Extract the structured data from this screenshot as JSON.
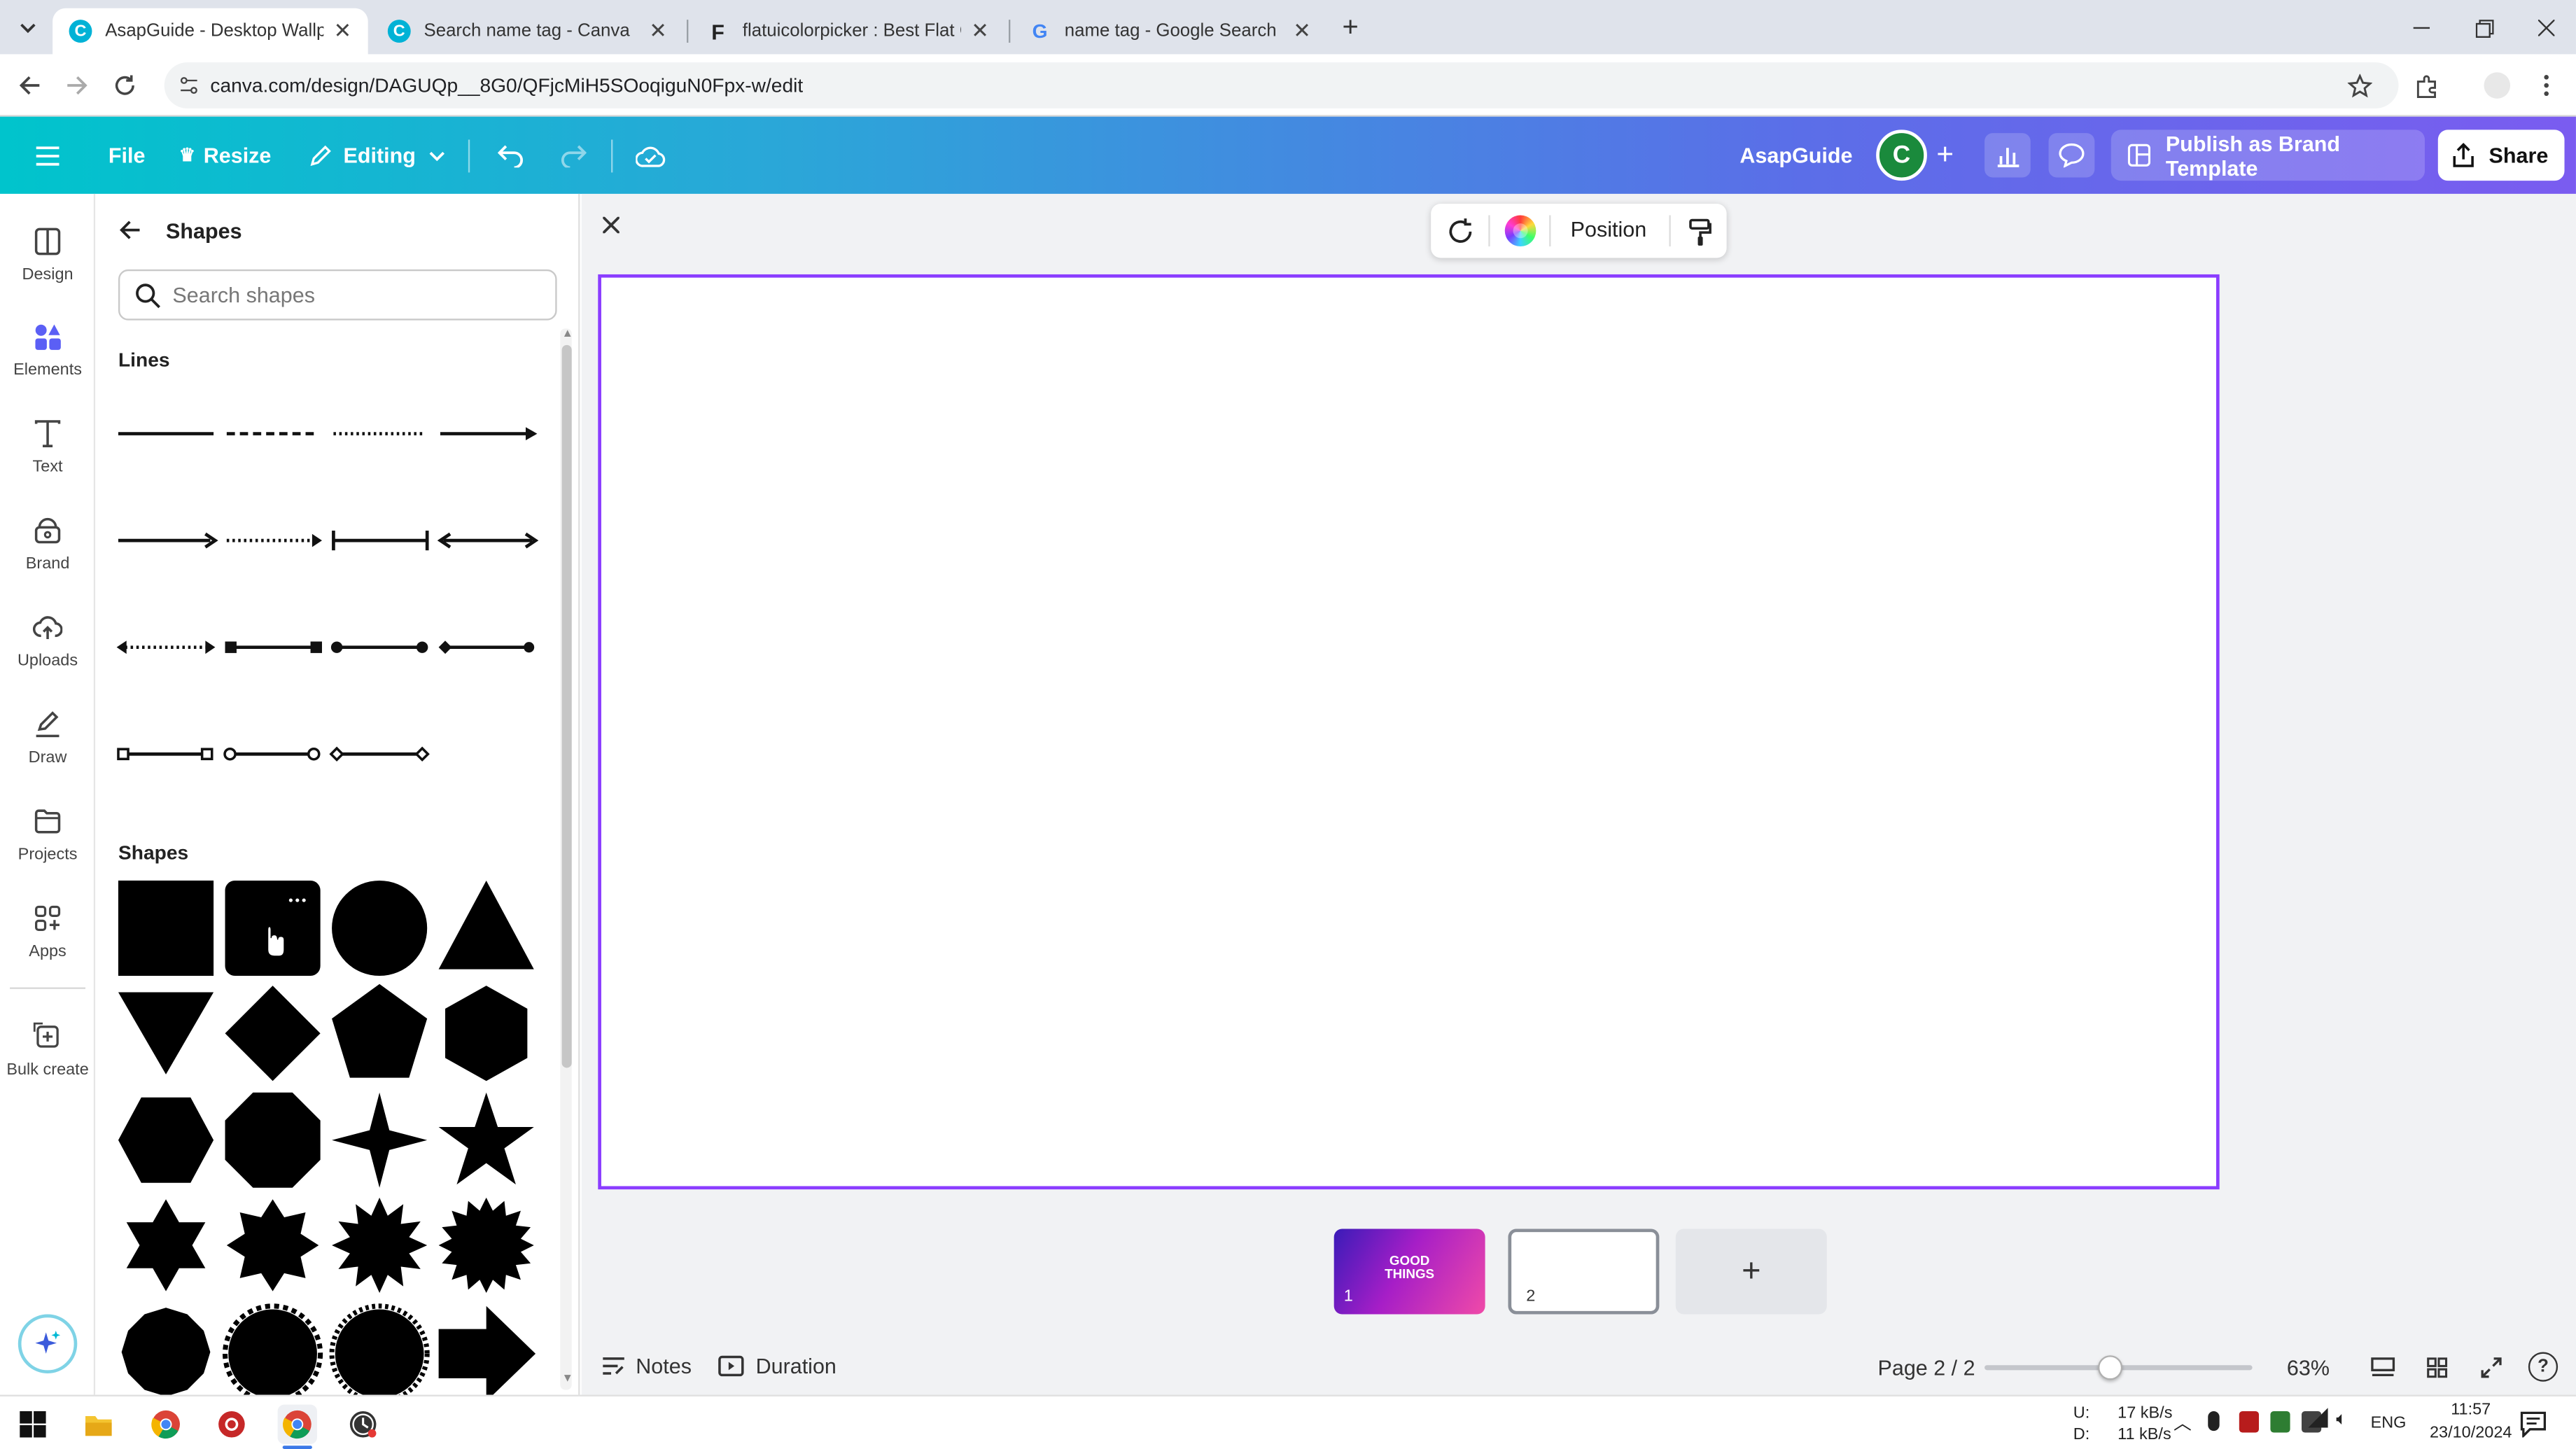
{
  "browser": {
    "tabs": [
      {
        "title": "AsapGuide - Desktop Wallpaper",
        "active": true,
        "icon": "canva-icon"
      },
      {
        "title": "Search name tag - Canva",
        "active": false,
        "icon": "canva-icon"
      },
      {
        "title": "flatuicolorpicker : Best Flat Colo",
        "active": false,
        "icon": "f-icon"
      },
      {
        "title": "name tag - Google Search",
        "active": false,
        "icon": "google-icon"
      }
    ],
    "url": "canva.com/design/DAGUQp__8G0/QFjcMiH5SOoqiguN0Fpx-w/edit"
  },
  "header": {
    "file": "File",
    "resize": "Resize",
    "editing": "Editing",
    "team": "AsapGuide",
    "avatar_letter": "C",
    "publish": "Publish as Brand Template",
    "share": "Share",
    "gradient_start": "#00c4cc",
    "gradient_end": "#7a5cf0"
  },
  "rail": [
    {
      "label": "Design",
      "icon": "design-icon"
    },
    {
      "label": "Elements",
      "icon": "elements-icon",
      "active": true
    },
    {
      "label": "Text",
      "icon": "text-icon"
    },
    {
      "label": "Brand",
      "icon": "brand-icon"
    },
    {
      "label": "Uploads",
      "icon": "uploads-icon"
    },
    {
      "label": "Draw",
      "icon": "draw-icon"
    },
    {
      "label": "Projects",
      "icon": "projects-icon"
    },
    {
      "label": "Apps",
      "icon": "apps-icon"
    },
    {
      "label": "Bulk create",
      "icon": "bulk-create-icon"
    }
  ],
  "panel": {
    "title": "Shapes",
    "search_placeholder": "Search shapes",
    "lines_title": "Lines",
    "shapes_title": "Shapes"
  },
  "canvas": {
    "position_label": "Position",
    "selection_color": "#8b3dff",
    "thumb1_text": "GOOD THINGS",
    "thumb1_num": "1",
    "thumb2_num": "2",
    "add_page": "+"
  },
  "footer": {
    "notes": "Notes",
    "duration": "Duration",
    "page_indicator": "Page 2 / 2",
    "zoom": "63%",
    "zoom_fraction": 0.47
  },
  "taskbar": {
    "net_up": "17 kB/s",
    "net_down": "11 kB/s",
    "net_up_label": "U:",
    "net_down_label": "D:",
    "lang": "ENG",
    "time": "11:57",
    "date": "23/10/2024"
  }
}
